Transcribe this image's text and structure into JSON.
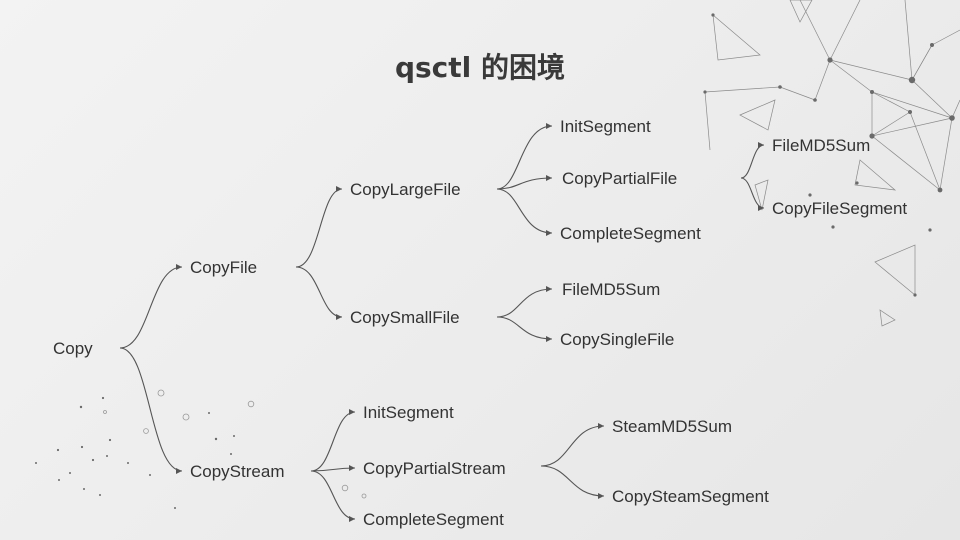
{
  "title": "qsctl 的困境",
  "tree": {
    "label": "Copy",
    "children": [
      {
        "label": "CopyFile",
        "children": [
          {
            "label": "CopyLargeFile",
            "children": [
              {
                "label": "InitSegment"
              },
              {
                "label": "CopyPartialFile",
                "children": [
                  {
                    "label": "FileMD5Sum"
                  },
                  {
                    "label": "CopyFileSegment"
                  }
                ]
              },
              {
                "label": "CompleteSegment"
              }
            ]
          },
          {
            "label": "CopySmallFile",
            "children": [
              {
                "label": "FileMD5Sum"
              },
              {
                "label": "CopySingleFile"
              }
            ]
          }
        ]
      },
      {
        "label": "CopyStream",
        "children": [
          {
            "label": "InitSegment"
          },
          {
            "label": "CopyPartialStream",
            "children": [
              {
                "label": "SteamMD5Sum"
              },
              {
                "label": "CopySteamSegment"
              }
            ]
          },
          {
            "label": "CompleteSegment"
          }
        ]
      }
    ]
  }
}
